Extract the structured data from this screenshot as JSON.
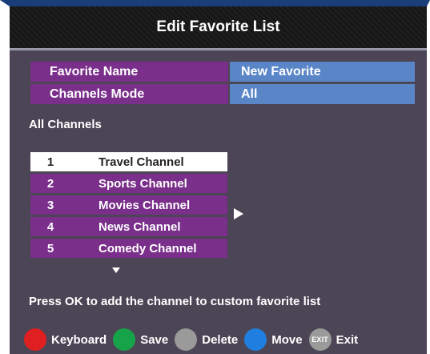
{
  "header": {
    "title": "Edit Favorite List"
  },
  "settings": {
    "favorite_name_label": "Favorite Name",
    "favorite_name_value": "New Favorite",
    "channels_mode_label": "Channels Mode",
    "channels_mode_value": "All"
  },
  "channel_list": {
    "section_label": "All Channels",
    "selected_index": 0,
    "items": [
      {
        "number": "1",
        "name": "Travel Channel"
      },
      {
        "number": "2",
        "name": "Sports Channel"
      },
      {
        "number": "3",
        "name": "Movies Channel"
      },
      {
        "number": "4",
        "name": "News Channel"
      },
      {
        "number": "5",
        "name": "Comedy Channel"
      }
    ]
  },
  "hint_text": "Press OK to add the channel to custom favorite list",
  "footer": {
    "keyboard_label": "Keyboard",
    "save_label": "Save",
    "delete_label": "Delete",
    "move_label": "Move",
    "exit_icon_text": "EXIT",
    "exit_label": "Exit"
  },
  "colors": {
    "red_button": "#e02020",
    "green_button": "#16a34a",
    "gray_button": "#9a9a9a",
    "blue_button": "#1f7fe0",
    "row_purple": "#7a2f8a",
    "value_blue": "#5a86c8",
    "background": "#4c4555"
  }
}
